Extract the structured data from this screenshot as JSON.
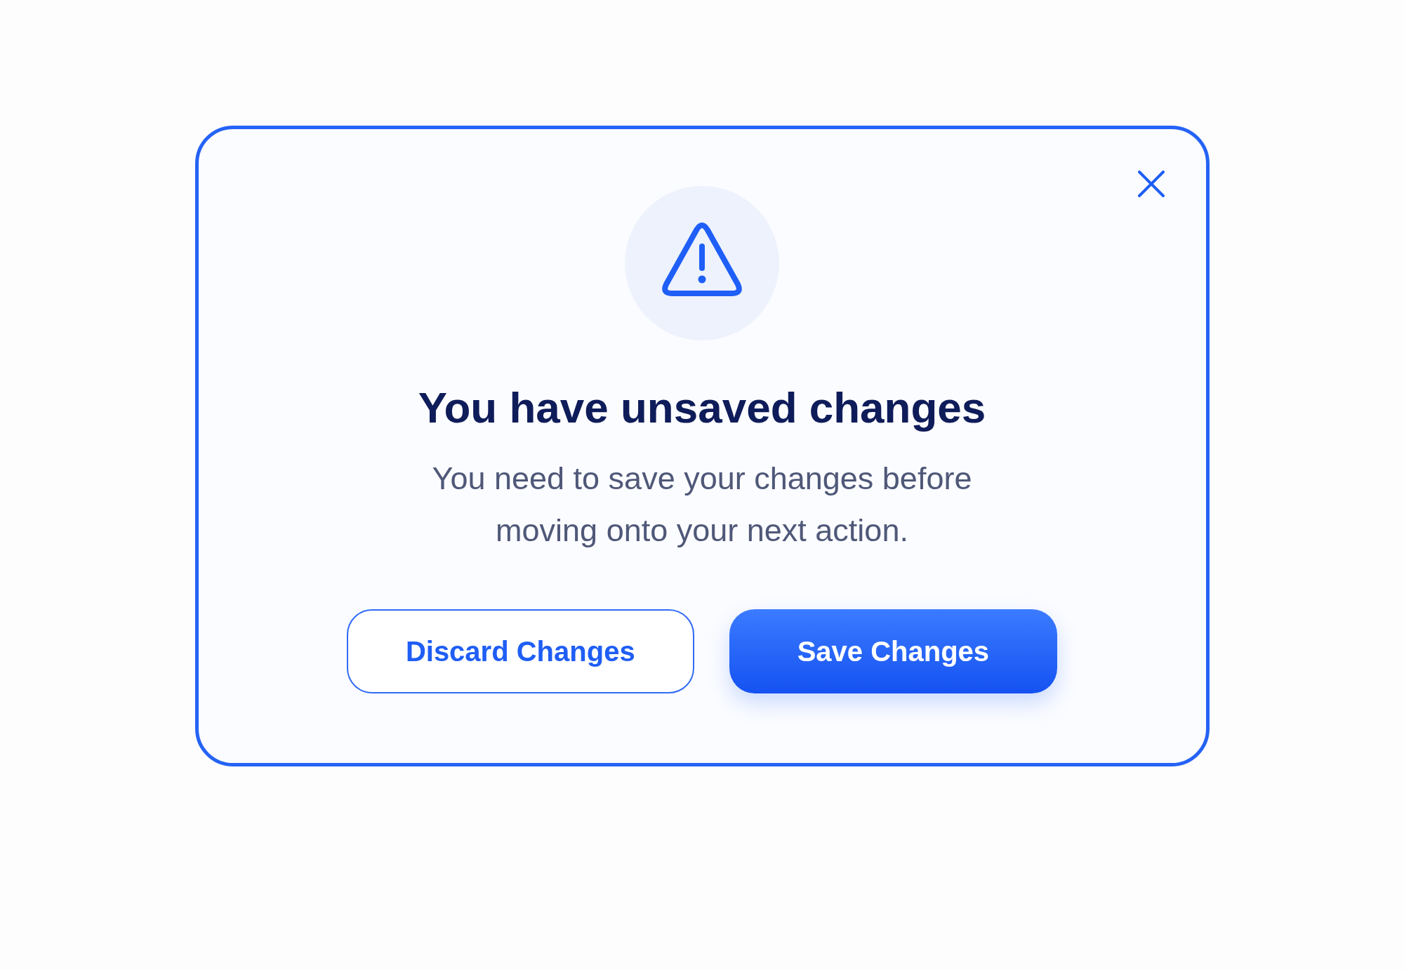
{
  "dialog": {
    "title": "You have unsaved changes",
    "message": "You need to save your changes before moving onto your next action.",
    "buttons": [
      {
        "label": "Discard Changes",
        "kind": "secondary"
      },
      {
        "label": "Save Changes",
        "kind": "primary"
      }
    ]
  }
}
